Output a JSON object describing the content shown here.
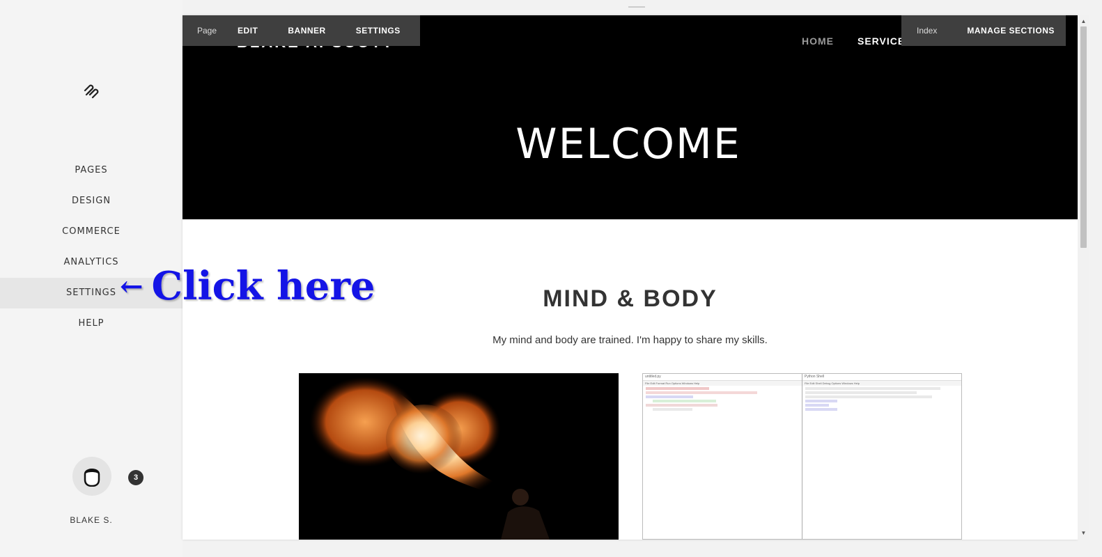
{
  "sidebar": {
    "logo_icon": "squarespace-logo-icon",
    "items": [
      {
        "label": "PAGES"
      },
      {
        "label": "DESIGN"
      },
      {
        "label": "COMMERCE"
      },
      {
        "label": "ANALYTICS"
      },
      {
        "label": "SETTINGS",
        "active": true
      },
      {
        "label": "HELP"
      }
    ],
    "user": {
      "name": "BLAKE S.",
      "notifications": "3",
      "avatar_icon": "user-avatar-icon"
    }
  },
  "annotation": {
    "arrow": "←",
    "text": "Click here",
    "color": "#1414e6"
  },
  "toolbar": {
    "page_label": "Page",
    "edit": "EDIT",
    "banner": "BANNER",
    "settings": "SETTINGS",
    "index_label": "Index",
    "manage_sections": "MANAGE SECTIONS"
  },
  "site": {
    "title": "BLAKE A. SCOTT",
    "nav": {
      "home": "HOME",
      "services": "SERVICES"
    },
    "banner_heading": "WELCOME",
    "section_title": "MIND & BODY",
    "section_subtitle": "My mind and body are trained. I'm happy to share my skills.",
    "images": [
      {
        "name": "fire-breathing-photo"
      },
      {
        "name": "python-idle-screenshot",
        "left_window": "untitled.py",
        "right_window": "Python Shell",
        "menu_left": "File  Edit  Format  Run  Options  Windows  Help",
        "menu_right": "File  Edit  Shell  Debug  Options  Windows  Help"
      }
    ]
  },
  "colors": {
    "banner_bg": "#000000",
    "toolbar_bg": "#3f3f3f",
    "sidebar_bg": "#f4f4f4"
  }
}
